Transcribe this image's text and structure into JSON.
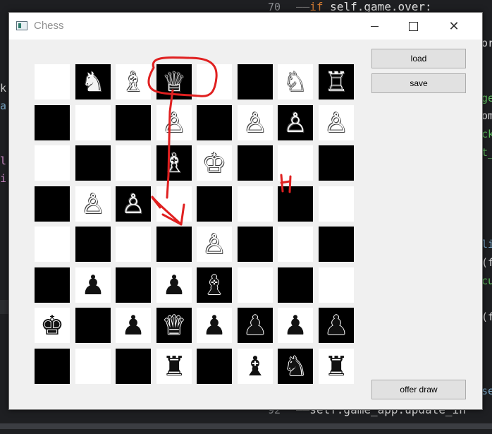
{
  "editor": {
    "top_line_number": "70",
    "top_line_keyword": "if",
    "top_line_code": "self.game.over:",
    "bottom_line_number": "92",
    "bottom_line_code": "self.game_app.update_in",
    "left_fragments": [
      "k",
      "a",
      "l",
      "i"
    ],
    "right_fragments": [
      "or",
      "ge",
      "om",
      "ck",
      "t_",
      "li",
      "(f",
      "cu",
      "(f",
      "se"
    ]
  },
  "window": {
    "title": "Chess",
    "icon": "window-app-icon",
    "minimize_icon": "minimize-icon",
    "maximize_icon": "maximize-icon",
    "close_icon": "close-icon",
    "close_glyph": "✕"
  },
  "buttons": {
    "load": "load",
    "save": "save",
    "offer_draw": "offer draw"
  },
  "board": {
    "rows": [
      [
        "",
        "♞w",
        "♗w",
        "♕w",
        "",
        "",
        "♘w",
        "♖w"
      ],
      [
        "",
        "",
        "",
        "♙w",
        "",
        "♙w",
        "♙w",
        "♙w"
      ],
      [
        "",
        "",
        "",
        "♗w",
        "♔w",
        "",
        "",
        ""
      ],
      [
        "",
        "♙w",
        "♙w",
        "",
        "",
        "",
        "",
        ""
      ],
      [
        "",
        "",
        "",
        "",
        "♙w",
        "",
        "",
        ""
      ],
      [
        "",
        "♟b",
        "",
        "♟b",
        "♝b",
        "",
        "",
        ""
      ],
      [
        "♚b",
        "",
        "♟b",
        "♛b",
        "♟b",
        "♟b",
        "♟b",
        "♟b"
      ],
      [
        "",
        "",
        "",
        "♜b",
        "",
        "♝b",
        "♞b",
        "♜b"
      ]
    ],
    "dark_squares": [
      [
        0,
        1,
        0,
        1,
        0,
        1,
        0,
        1
      ],
      [
        1,
        0,
        1,
        0,
        1,
        0,
        1,
        0
      ],
      [
        0,
        1,
        0,
        1,
        0,
        1,
        0,
        1
      ],
      [
        1,
        0,
        1,
        0,
        1,
        0,
        1,
        0
      ],
      [
        0,
        1,
        0,
        1,
        0,
        1,
        0,
        1
      ],
      [
        1,
        0,
        1,
        0,
        1,
        0,
        1,
        0
      ],
      [
        0,
        1,
        0,
        1,
        0,
        1,
        0,
        1
      ],
      [
        1,
        0,
        1,
        0,
        1,
        0,
        1,
        0
      ]
    ]
  },
  "annotation": {
    "color": "#e02020",
    "description_icon": "red-handwritten-annotation"
  }
}
